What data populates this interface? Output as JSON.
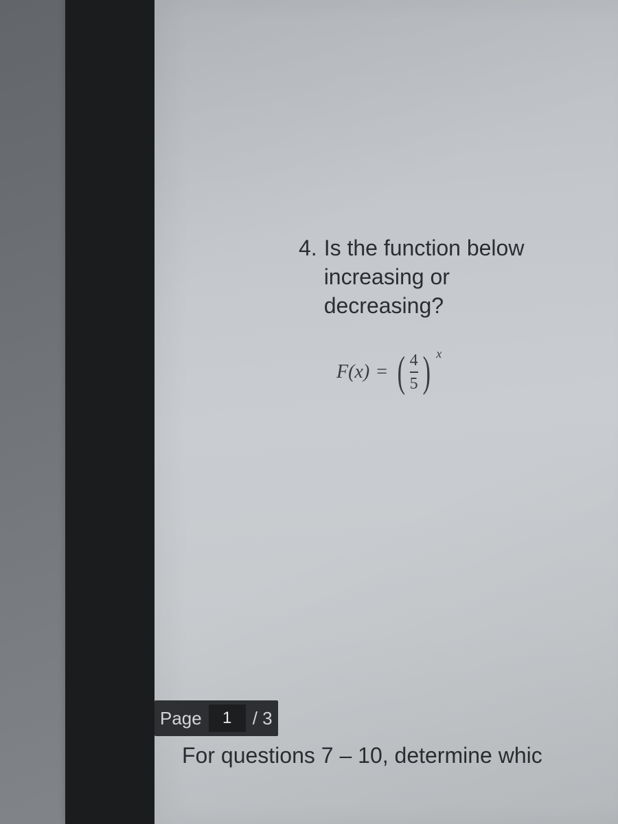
{
  "question": {
    "number": "4.",
    "text_line1": "Is the function below",
    "text_line2": "increasing or",
    "text_line3": "decreasing?"
  },
  "formula": {
    "lhs": "F(x)",
    "equals": "=",
    "numerator": "4",
    "denominator": "5",
    "exponent": "x"
  },
  "pager": {
    "label": "Page",
    "current": "1",
    "total": "/ 3"
  },
  "instructions": {
    "text": "For questions 7 – 10, determine whic"
  }
}
